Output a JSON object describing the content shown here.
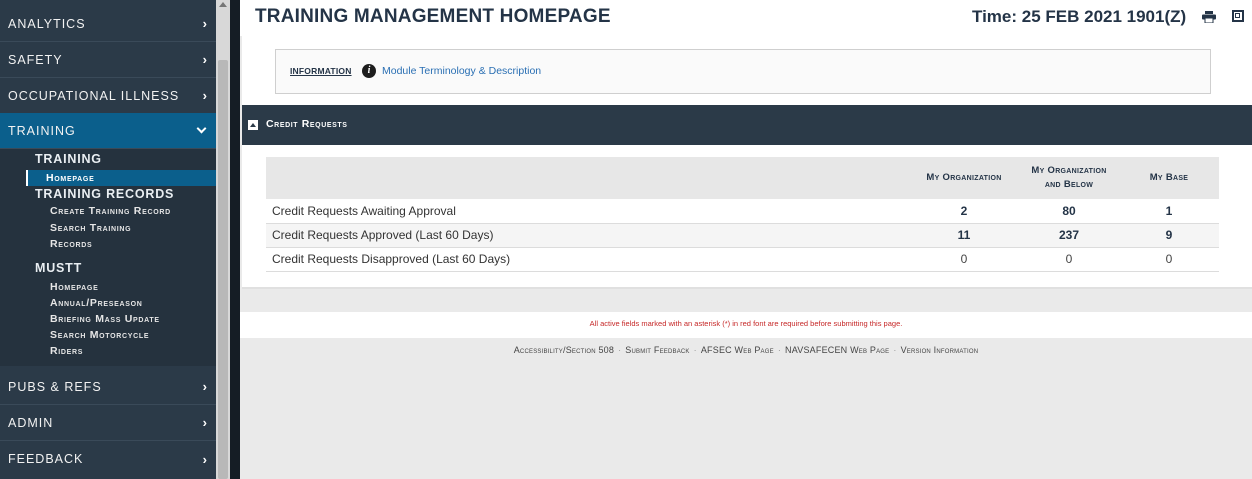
{
  "sidebar": {
    "items": [
      {
        "label": "ANALYTICS"
      },
      {
        "label": "SAFETY"
      },
      {
        "label": "OCCUPATIONAL ILLNESS"
      },
      {
        "label": "TRAINING"
      },
      {
        "label": "PUBS & REFS"
      },
      {
        "label": "ADMIN"
      },
      {
        "label": "FEEDBACK"
      }
    ],
    "training_sub": {
      "heading": "TRAINING",
      "homepage": "Homepage",
      "records_heading": "TRAINING RECORDS",
      "create_record": "Create Training Record",
      "search_records_line1": "Search Training",
      "search_records_line2": "Records",
      "mustt_heading": "MUSTT",
      "mustt_homepage": "Homepage",
      "mustt_annual": "Annual/Preseason",
      "mustt_briefing": "Briefing Mass Update",
      "mustt_search_line1": "Search Motorcycle",
      "mustt_search_line2": "Riders"
    }
  },
  "header": {
    "title": "TRAINING MANAGEMENT HOMEPAGE",
    "time": "Time: 25 FEB 2021 1901(Z)"
  },
  "info": {
    "label": "INFORMATION",
    "link": "Module Terminology & Description"
  },
  "panel": {
    "title": "Credit Requests",
    "columns": [
      "My Organization",
      "My Organization",
      "and Below",
      "My Base"
    ],
    "rows": [
      {
        "label": "Credit Requests Awaiting Approval",
        "org": "2",
        "org_below": "80",
        "base": "1"
      },
      {
        "label": "Credit Requests Approved (Last 60 Days)",
        "org": "11",
        "org_below": "237",
        "base": "9"
      },
      {
        "label": "Credit Requests Disapproved (Last 60 Days)",
        "org": "0",
        "org_below": "0",
        "base": "0"
      }
    ]
  },
  "footer": {
    "note": "All active fields marked with an asterisk (*) in red font are required before submitting this page.",
    "links": [
      "Accessibility/Section 508",
      "Submit Feedback",
      "AFSEC Web Page",
      "NAVSAFECEN Web Page",
      "Version Information"
    ]
  },
  "colors": {
    "sidebar_bg": "#2b3a48",
    "accent": "#0b5f8c",
    "title_color": "#243447",
    "required_red": "#c62828"
  }
}
